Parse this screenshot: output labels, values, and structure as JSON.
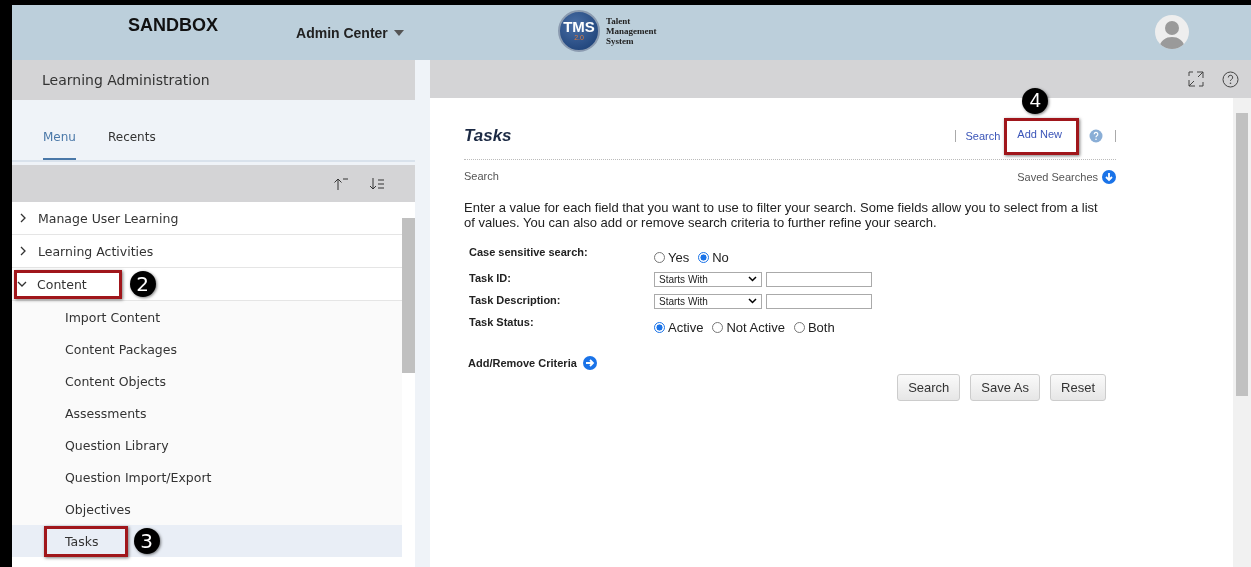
{
  "header": {
    "environment": "SANDBOX",
    "app_menu": "Admin Center",
    "logo_mark": "TMS",
    "logo_version": "2.0",
    "logo_text": [
      "Talent",
      "Management",
      "System"
    ]
  },
  "sidebar": {
    "title": "Learning Administration",
    "tabs": [
      {
        "label": "Menu",
        "selected": true
      },
      {
        "label": "Recents",
        "selected": false
      }
    ],
    "items": [
      {
        "label": "Manage User Learning",
        "expanded": false
      },
      {
        "label": "Learning Activities",
        "expanded": false
      },
      {
        "label": "Content",
        "expanded": true,
        "callout": "2",
        "children": [
          {
            "label": "Import Content",
            "selected": false
          },
          {
            "label": "Content Packages",
            "selected": false
          },
          {
            "label": "Content Objects",
            "selected": false
          },
          {
            "label": "Assessments",
            "selected": false
          },
          {
            "label": "Question Library",
            "selected": false
          },
          {
            "label": "Question Import/Export",
            "selected": false
          },
          {
            "label": "Objectives",
            "selected": false
          },
          {
            "label": "Tasks",
            "selected": true,
            "callout": "3"
          }
        ]
      }
    ]
  },
  "main": {
    "title": "Tasks",
    "links": [
      {
        "label": "Search"
      },
      {
        "label": "Add New",
        "callout": "4"
      }
    ],
    "section": "Search",
    "saved_searches": "Saved Searches",
    "intro": "Enter a value for each field that you want to use to filter your search. Some fields allow you to select from a list of values. You can also add or remove search criteria to further refine your search.",
    "fields": [
      {
        "label": "Case sensitive search:",
        "kind": "radio",
        "options": [
          {
            "label": "Yes",
            "selected": false
          },
          {
            "label": "No",
            "selected": true
          }
        ]
      },
      {
        "label": "Task ID:",
        "kind": "text",
        "operator": "Starts With"
      },
      {
        "label": "Task Description:",
        "kind": "text",
        "operator": "Starts With"
      },
      {
        "label": "Task Status:",
        "kind": "radio",
        "options": [
          {
            "label": "Active",
            "selected": true
          },
          {
            "label": "Not Active",
            "selected": false
          },
          {
            "label": "Both",
            "selected": false
          }
        ]
      }
    ],
    "criteria": "Add/Remove Criteria",
    "buttons": [
      "Search",
      "Save As",
      "Reset"
    ]
  }
}
